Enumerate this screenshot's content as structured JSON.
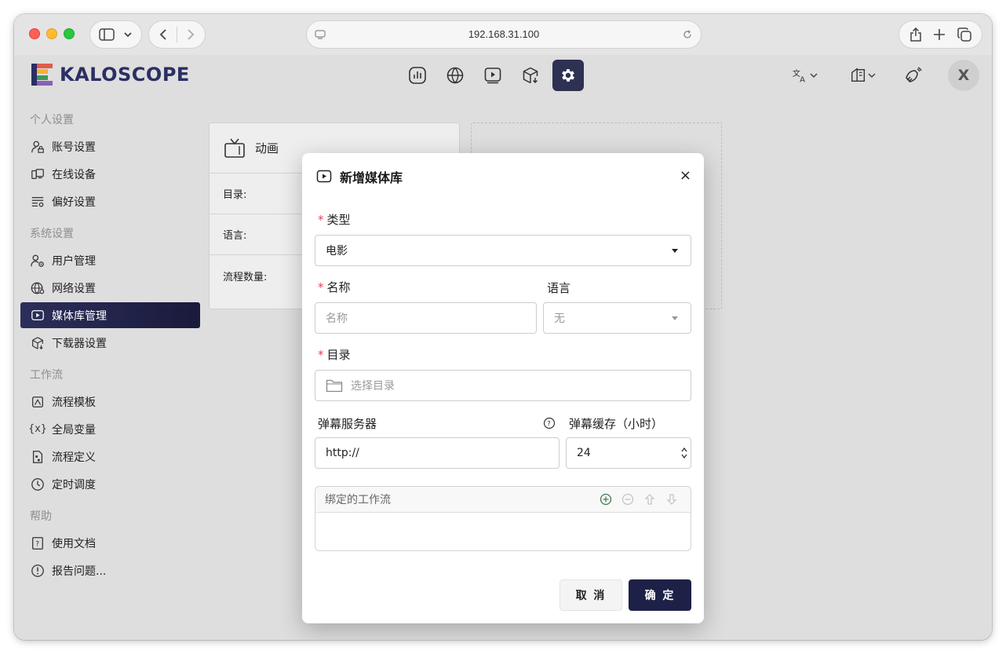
{
  "browser": {
    "url": "192.168.31.100"
  },
  "app": {
    "logo_text": "KALOSCOPE",
    "avatar_letter": "X"
  },
  "sidebar": {
    "sections": [
      {
        "title": "个人设置",
        "items": [
          {
            "label": "账号设置",
            "icon": "user-lock-icon"
          },
          {
            "label": "在线设备",
            "icon": "devices-icon"
          },
          {
            "label": "偏好设置",
            "icon": "preferences-icon"
          }
        ]
      },
      {
        "title": "系统设置",
        "items": [
          {
            "label": "用户管理",
            "icon": "users-gear-icon"
          },
          {
            "label": "网络设置",
            "icon": "globe-gear-icon"
          },
          {
            "label": "媒体库管理",
            "icon": "play-square-icon",
            "active": true
          },
          {
            "label": "下载器设置",
            "icon": "box-download-icon"
          }
        ]
      },
      {
        "title": "工作流",
        "items": [
          {
            "label": "流程模板",
            "icon": "template-icon"
          },
          {
            "label": "全局变量",
            "icon": "variable-icon"
          },
          {
            "label": "流程定义",
            "icon": "flow-definition-icon"
          },
          {
            "label": "定时调度",
            "icon": "clock-icon"
          }
        ]
      },
      {
        "title": "帮助",
        "items": [
          {
            "label": "使用文档",
            "icon": "question-doc-icon"
          },
          {
            "label": "报告问题...",
            "icon": "alert-circle-icon"
          }
        ]
      }
    ]
  },
  "card": {
    "title": "动画",
    "rows": [
      "目录:",
      "语言:",
      "流程数量:"
    ]
  },
  "modal": {
    "title": "新增媒体库",
    "close": "×",
    "type_label": "类型",
    "type_value": "电影",
    "name_label": "名称",
    "name_placeholder": "名称",
    "language_label": "语言",
    "language_value": "无",
    "dir_label": "目录",
    "dir_placeholder": "选择目录",
    "danmaku_server_label": "弹幕服务器",
    "danmaku_server_value": "http://",
    "danmaku_cache_label": "弹幕缓存（小时）",
    "danmaku_cache_value": "24",
    "workflow_label": "绑定的工作流",
    "cancel": "取 消",
    "confirm": "确 定"
  }
}
